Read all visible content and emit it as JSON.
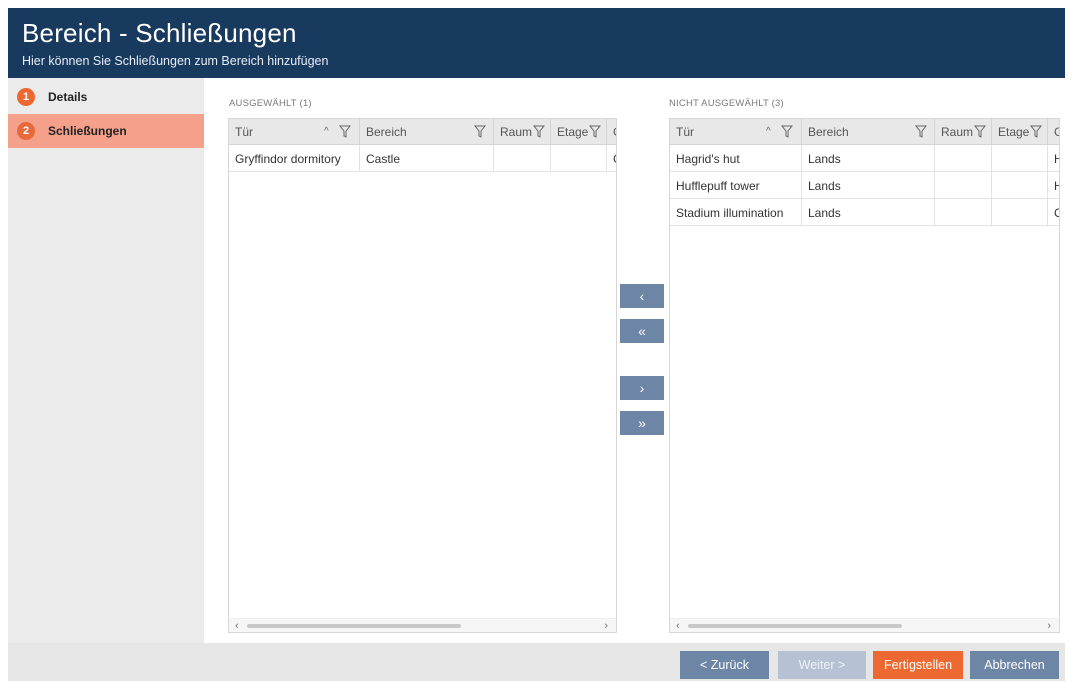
{
  "header": {
    "title": "Bereich - Schließungen",
    "subtitle": "Hier können Sie Schließungen zum Bereich hinzufügen"
  },
  "steps": [
    {
      "num": "1",
      "label": "Details",
      "active": false
    },
    {
      "num": "2",
      "label": "Schließungen",
      "active": true
    }
  ],
  "selected": {
    "label": "AUSGEWÄHLT (1)",
    "columns": [
      "Tür",
      "Bereich",
      "Raum",
      "Etage",
      "G"
    ],
    "rows": [
      [
        "Gryffindor dormitory",
        "Castle",
        "",
        "",
        "G"
      ]
    ]
  },
  "unselected": {
    "label": "NICHT AUSGEWÄHLT (3)",
    "columns": [
      "Tür",
      "Bereich",
      "Raum",
      "Etage",
      "G"
    ],
    "rows": [
      [
        "Hagrid's hut",
        "Lands",
        "",
        "",
        "H"
      ],
      [
        "Hufflepuff tower",
        "Lands",
        "",
        "",
        "H"
      ],
      [
        "Stadium illumination",
        "Lands",
        "",
        "",
        "C"
      ]
    ]
  },
  "transfer": {
    "move_left": "‹",
    "move_all_left": "«",
    "move_right": "›",
    "move_all_right": "»"
  },
  "footer": {
    "back": "< Zurück",
    "next": "Weiter >",
    "finish": "Fertigstellen",
    "cancel": "Abbrechen"
  },
  "colors": {
    "header_bg": "#183a5e",
    "accent_orange": "#ec6a31",
    "active_step_bg": "#f4a08a",
    "button_blue": "#6e86a6"
  }
}
